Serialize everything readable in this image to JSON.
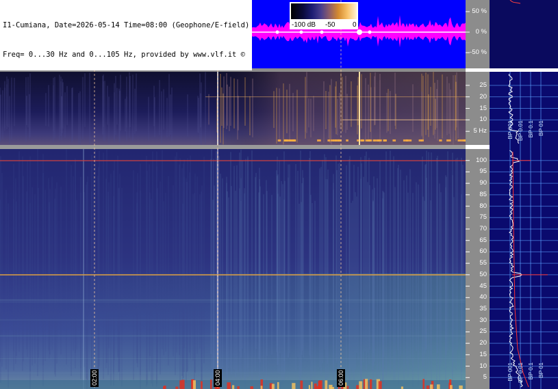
{
  "header": {
    "line1": "I1-Cumiana, Date=2026-05-14 Time=08:00 (Geophone/E-field)",
    "line2": "Freq= 0...30 Hz and 0...105 Hz, provided by www.vlf.it ©"
  },
  "colorbar": {
    "labels": [
      "-100 dB",
      "-50",
      "0"
    ]
  },
  "chart_data": [
    {
      "type": "area",
      "panel": "waveform amplitude",
      "ylabel_ticks": [
        "50 %",
        "0 %",
        "-50 %"
      ],
      "y_ticks": [
        50,
        0,
        -50
      ]
    },
    {
      "type": "heatmap",
      "panel": "spectrogram 0...30 Hz",
      "y_ticks": [
        25,
        20,
        15,
        10,
        5
      ],
      "y_tick_labels": [
        "25",
        "20",
        "15",
        "10",
        "5 Hz"
      ],
      "ylim": [
        0,
        30
      ]
    },
    {
      "type": "heatmap",
      "panel": "spectrogram 0...105 Hz",
      "y_ticks": [
        100,
        95,
        90,
        85,
        80,
        75,
        70,
        65,
        60,
        55,
        50,
        45,
        40,
        35,
        30,
        25,
        20,
        15,
        10,
        5
      ],
      "ylim": [
        0,
        105
      ],
      "time_markers": [
        "02:00",
        "04:00",
        "06:00"
      ],
      "strong_lines_hz": [
        50,
        100
      ]
    },
    {
      "type": "line",
      "panel": "average spectrum",
      "bp_labels_top": [
        "BP 001",
        "BP 0.01",
        "BP 0.1",
        "BP 01"
      ],
      "bp_labels_bottom": [
        "BP 001",
        "BP 0.01",
        "BP 0.1",
        "BP 01"
      ]
    }
  ],
  "colors": {
    "waveform_bg": "#0000ff",
    "waveform_trace": "#ff00ff",
    "right_bg": "#0a0a6e",
    "grid_blue": "#5aa0ff",
    "axis_grey": "#8c8c8c"
  }
}
